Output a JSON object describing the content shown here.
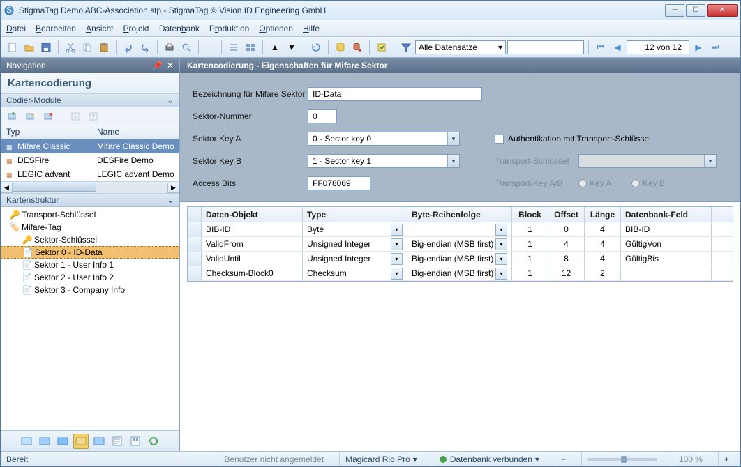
{
  "title": "StigmaTag Demo ABC-Association.stp - StigmaTag    © Vision ID Engineering GmbH",
  "menu": [
    "Datei",
    "Bearbeiten",
    "Ansicht",
    "Projekt",
    "Datenbank",
    "Produktion",
    "Optionen",
    "Hilfe"
  ],
  "toolbar": {
    "filter_combo": "Alle Datensätze",
    "record_counter": "12 von 12"
  },
  "nav": {
    "header": "Navigation",
    "title": "Kartencodierung",
    "codier_panel": "Codier-Module",
    "grid": {
      "cols": [
        "Typ",
        "Name"
      ],
      "rows": [
        {
          "typ": "Mifare Classic",
          "name": "Mifare Classic Demo",
          "sel": true
        },
        {
          "typ": "DESFire",
          "name": "DESFire Demo",
          "sel": false
        },
        {
          "typ": "LEGIC advant",
          "name": "LEGIC advant Demo",
          "sel": false
        }
      ]
    },
    "struct_panel": "Kartenstruktur",
    "tree": [
      {
        "label": "Transport-Schlüssel",
        "indent": 0,
        "icon": "key",
        "sel": false
      },
      {
        "label": "Mifare-Tag",
        "indent": 0,
        "icon": "tag",
        "sel": false
      },
      {
        "label": "Sektor-Schlüssel",
        "indent": 1,
        "icon": "key",
        "sel": false
      },
      {
        "label": "Sektor 0 - ID-Data",
        "indent": 1,
        "icon": "page",
        "sel": true
      },
      {
        "label": "Sektor 1 - User Info 1",
        "indent": 1,
        "icon": "page",
        "sel": false
      },
      {
        "label": "Sektor 2 - User Info 2",
        "indent": 1,
        "icon": "page",
        "sel": false
      },
      {
        "label": "Sektor 3 - Company Info",
        "indent": 1,
        "icon": "page",
        "sel": false
      }
    ]
  },
  "content": {
    "header": "Kartencodierung - Eigenschaften für Mifare Sektor",
    "fields": {
      "bez_label": "Bezeichnung für Mifare Sektor",
      "bez_value": "ID-Data",
      "sektor_nr_label": "Sektor-Nummer",
      "sektor_nr_value": "0",
      "key_a_label": "Sektor Key A",
      "key_a_value": "0 - Sector key 0",
      "key_b_label": "Sektor Key B",
      "key_b_value": "1 - Sector key 1",
      "access_label": "Access Bits",
      "access_value": "FF078069",
      "auth_chk_label": "Authentikation mit Transport-Schlüssel",
      "transport_key_label": "Transport-Schlüssel",
      "transport_ab_label": "Transport-Key A/B",
      "radio_a": "Key A",
      "radio_b": "Key B"
    },
    "table": {
      "cols": [
        "Daten-Objekt",
        "Type",
        "Byte-Reihenfolge",
        "Block",
        "Offset",
        "Länge",
        "Datenbank-Feld"
      ],
      "rows": [
        {
          "obj": "BIB-ID",
          "type": "Byte",
          "byte": "",
          "block": "1",
          "offset": "0",
          "len": "4",
          "db": "BIB-ID"
        },
        {
          "obj": "ValidFrom",
          "type": "Unsigned Integer",
          "byte": "Big-endian (MSB first)",
          "block": "1",
          "offset": "4",
          "len": "4",
          "db": "GültigVon"
        },
        {
          "obj": "ValidUntil",
          "type": "Unsigned Integer",
          "byte": "Big-endian (MSB first)",
          "block": "1",
          "offset": "8",
          "len": "4",
          "db": "GültigBis"
        },
        {
          "obj": "Checksum-Block0",
          "type": "Checksum",
          "byte": "Big-endian (MSB first)",
          "block": "1",
          "offset": "12",
          "len": "2",
          "db": ""
        }
      ]
    }
  },
  "status": {
    "ready": "Bereit",
    "user": "Benutzer nicht angemeldet",
    "printer": "Magicard Rio Pro",
    "db": "Datenbank verbunden",
    "zoom": "100 %"
  }
}
